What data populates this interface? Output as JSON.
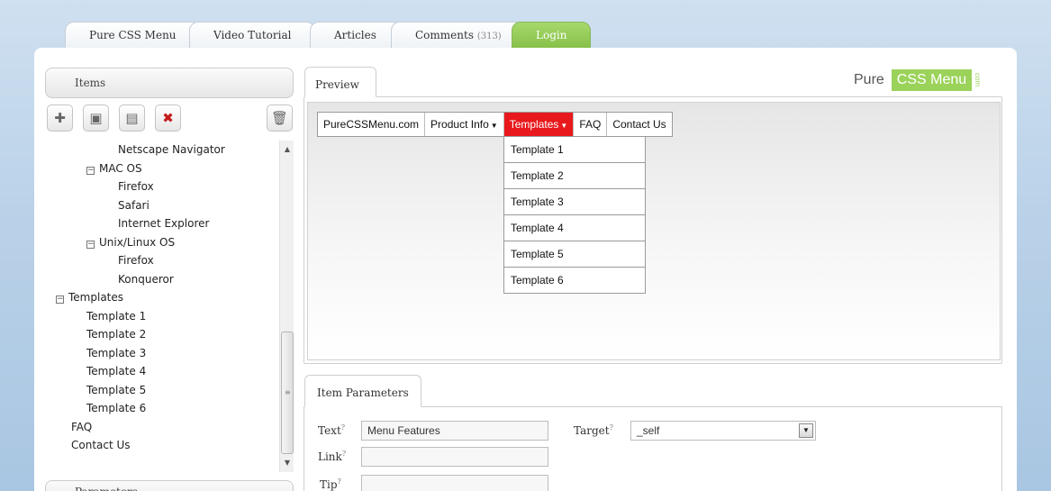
{
  "top_tabs": {
    "pure_css_menu": "Pure CSS Menu",
    "video_tutorial": "Video Tutorial",
    "articles": "Articles",
    "comments": "Comments",
    "comments_count": "(313)",
    "login": "Login"
  },
  "left": {
    "items_title": "Items",
    "params_title": "Parameters",
    "toolbar": {
      "add_icon": "plus-icon",
      "add_sub_icon": "add-subitem-icon",
      "add_after_icon": "add-after-icon",
      "delete_icon": "delete-x-icon",
      "trash_icon": "trash-icon"
    },
    "tree": [
      "Netscape Navigator",
      "MAC OS",
      "Firefox",
      "Safari",
      "Internet Explorer",
      "Unix/Linux OS",
      "Firefox",
      "Konqueror",
      "Templates",
      "Template 1",
      "Template 2",
      "Template 3",
      "Template 4",
      "Template 5",
      "Template 6",
      "FAQ",
      "Contact Us"
    ]
  },
  "preview": {
    "tab_label": "Preview",
    "menu": [
      "PureCSSMenu.com",
      "Product Info",
      "Templates",
      "FAQ",
      "Contact Us"
    ],
    "dropdown": [
      "Template 1",
      "Template 2",
      "Template 3",
      "Template 4",
      "Template 5",
      "Template 6"
    ]
  },
  "logo": {
    "pure": "Pure",
    "css_menu": "CSS Menu",
    "com": "com"
  },
  "item_params": {
    "tab_label": "Item Parameters",
    "text_label": "Text",
    "text_value": "Menu Features",
    "target_label": "Target",
    "target_value": "_self",
    "link_label": "Link",
    "link_value": "",
    "tip_label": "Tip",
    "tip_value": "",
    "help_mark": "?"
  },
  "colors": {
    "active_menu": "#e8191c",
    "brand_green": "#9bd25a",
    "background": "#b9d1e8"
  }
}
